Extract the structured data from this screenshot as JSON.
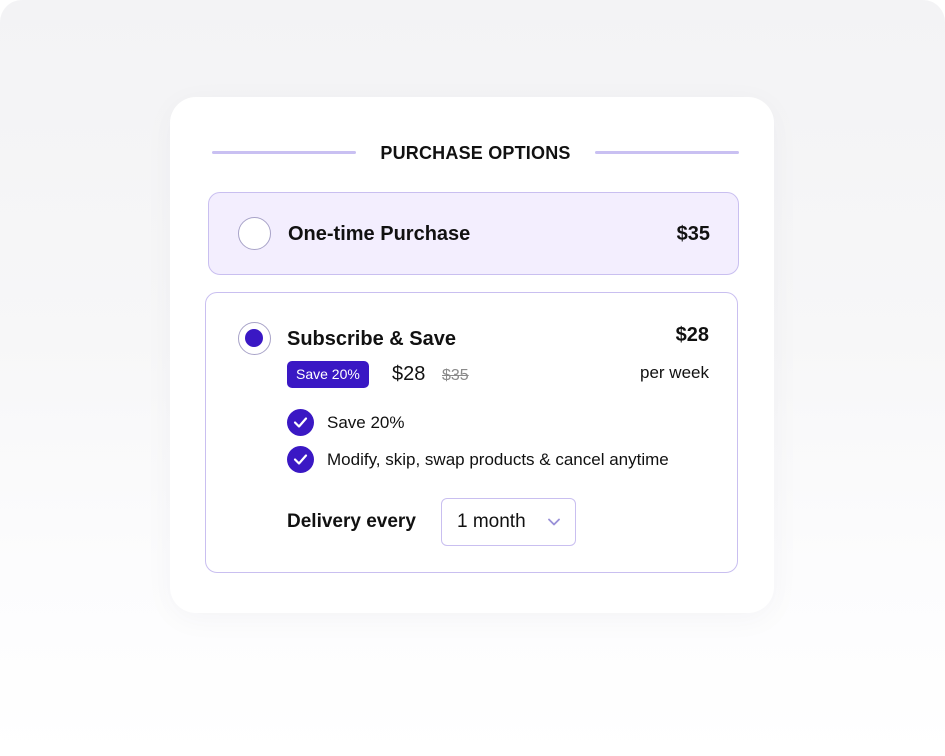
{
  "heading": "PURCHASE OPTIONS",
  "one_time": {
    "label": "One-time Purchase",
    "price": "$35",
    "selected": false
  },
  "subscribe": {
    "label": "Subscribe & Save",
    "price": "$28",
    "period": "per week",
    "badge": "Save 20%",
    "sale_price": "$28",
    "original_price": "$35",
    "selected": true,
    "benefits": [
      "Save 20%",
      "Modify, skip, swap products & cancel anytime"
    ],
    "delivery_label": "Delivery every",
    "delivery_value": "1 month"
  },
  "colors": {
    "accent": "#3a18c4",
    "border": "#c9bff0",
    "selected_bg": "#f3eefe"
  },
  "icons": [
    "check-icon",
    "chevron-down-icon"
  ]
}
